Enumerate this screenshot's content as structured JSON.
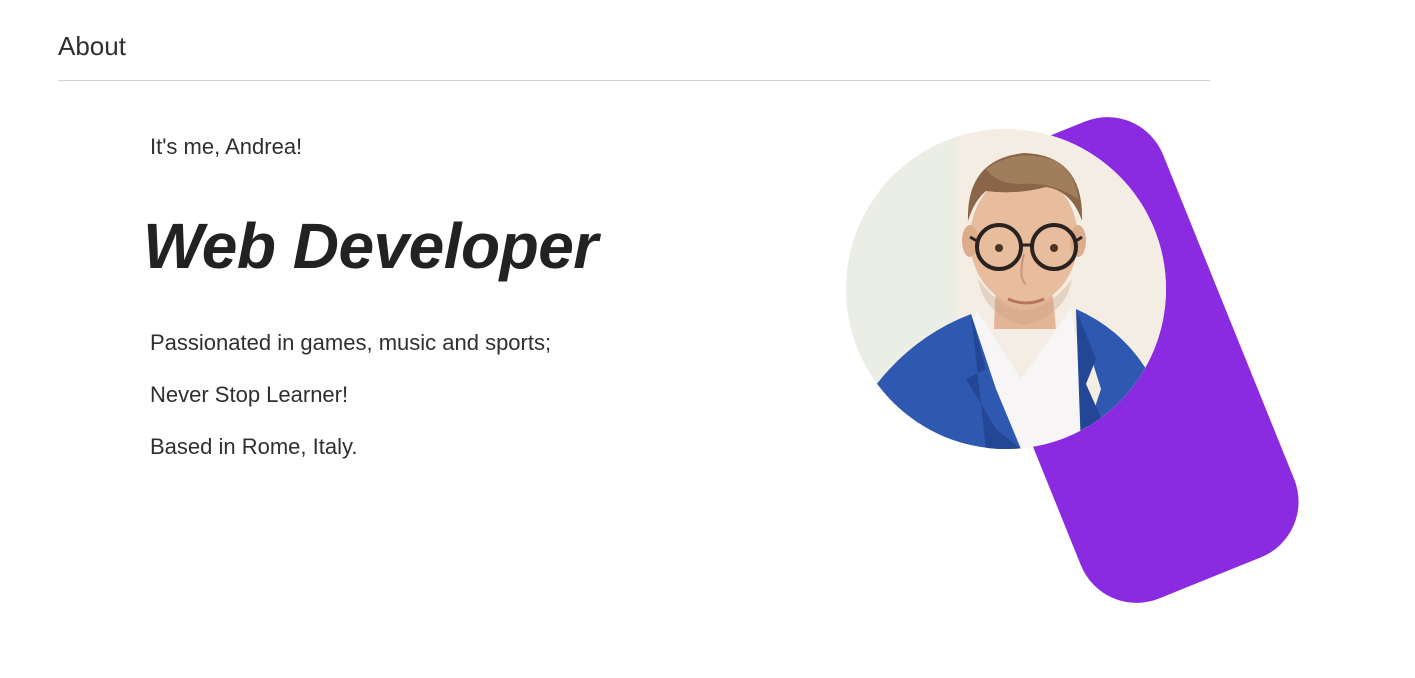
{
  "section": {
    "title": "About"
  },
  "hero": {
    "greeting": "It's me, Andrea!",
    "role": "Web Developer",
    "bio": [
      "Passionated in games, music and sports;",
      "Never Stop Learner!",
      "Based in Rome, Italy."
    ]
  },
  "visual": {
    "accent_color": "#8A2BE2",
    "portrait_icon": "profile-photo"
  }
}
